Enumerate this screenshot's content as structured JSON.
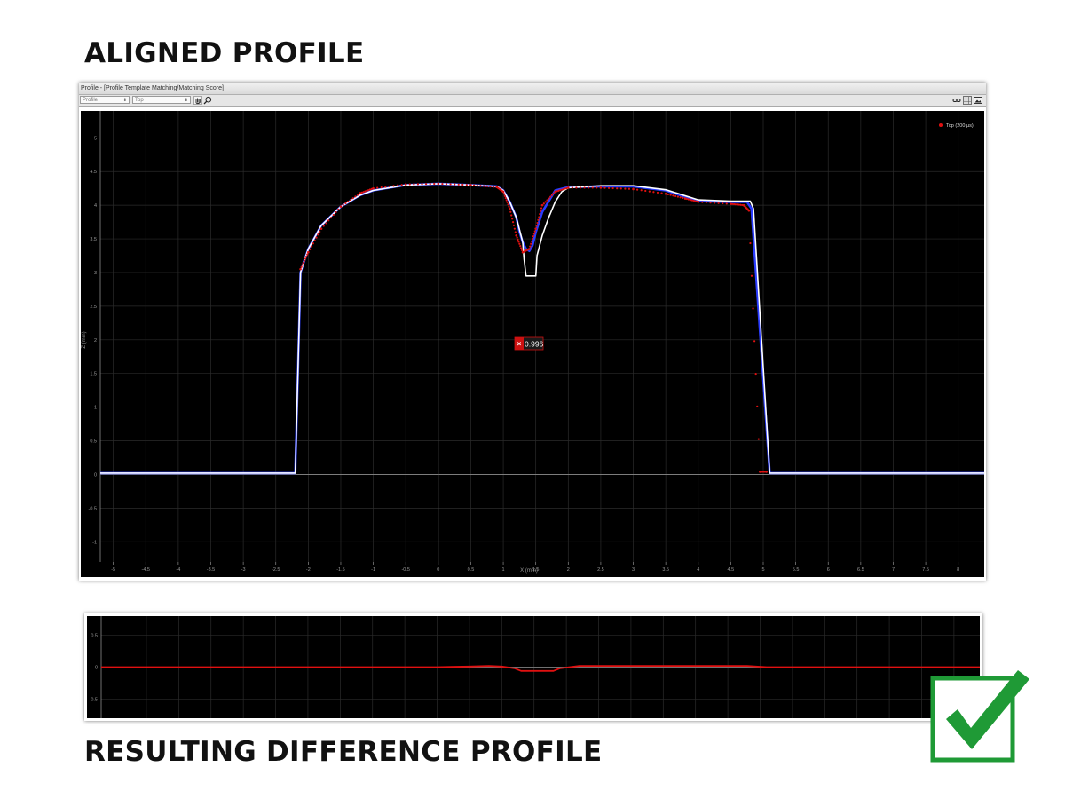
{
  "headings": {
    "top": "ALIGNED PROFILE",
    "bottom": "RESULTING DIFFERENCE PROFILE"
  },
  "window": {
    "title": "Profile - [Profile Template Matching/Matching Score]",
    "combo_1": "Profile",
    "combo_2": "Top",
    "toolbar_icons": [
      "hand-icon",
      "search-icon",
      "link-icon",
      "grid-icon",
      "screenshot-icon"
    ]
  },
  "colors": {
    "background": "#000000",
    "grid": "#2b2b2b",
    "axis": "#8c8c8c",
    "template": "#e01010",
    "profile_blue": "#2a3cff",
    "profile_white": "#ffffff",
    "badge": "#cc1111",
    "checkmark": "#1f9a36"
  },
  "badge": {
    "icon": "close-icon",
    "score": "0.996"
  },
  "chart_data": [
    {
      "type": "line",
      "xlabel": "X (mm)",
      "ylabel": "Z (mm)",
      "xlim": [
        -5.2,
        8.4
      ],
      "ylim": [
        -1.3,
        5.4
      ],
      "xticks": [
        "-5",
        "-4.5",
        "-4",
        "-3.5",
        "-3",
        "-2.5",
        "-2",
        "-1.5",
        "-1",
        "-0.5",
        "0",
        "0.5",
        "1",
        "1.5",
        "2",
        "2.5",
        "3",
        "3.5",
        "4",
        "4.5",
        "5",
        "5.5",
        "6",
        "6.5",
        "7",
        "7.5",
        "8"
      ],
      "yticks": [
        "-1",
        "-0.5",
        "0",
        "0.5",
        "1",
        "1.5",
        "2",
        "2.5",
        "3",
        "3.5",
        "4",
        "4.5",
        "5"
      ],
      "legend": {
        "position": "top-right",
        "entries": [
          "Top (200 µs)"
        ]
      },
      "grid": true,
      "series": [
        {
          "name": "",
          "color": "#2a3cff",
          "x": [
            -5.2,
            -2.2,
            -2.12,
            -2.07,
            -2.0,
            -1.8,
            -1.5,
            -1.2,
            -1.0,
            -0.5,
            0.0,
            0.5,
            0.9,
            1.0,
            1.1,
            1.2,
            1.25,
            1.3,
            1.35,
            1.4,
            1.45,
            1.5,
            1.6,
            1.8,
            2.0,
            2.5,
            3.0,
            3.5,
            4.0,
            4.5,
            4.75,
            4.82,
            5.1,
            8.4
          ],
          "y": [
            0.02,
            0.02,
            3.0,
            3.15,
            3.35,
            3.7,
            3.98,
            4.15,
            4.22,
            4.3,
            4.32,
            4.3,
            4.28,
            4.22,
            4.05,
            3.82,
            3.6,
            3.45,
            3.35,
            3.32,
            3.4,
            3.6,
            3.9,
            4.22,
            4.27,
            4.28,
            4.28,
            4.22,
            4.06,
            4.05,
            4.05,
            3.95,
            0.02,
            0.02
          ]
        },
        {
          "name": "",
          "color": "#ffffff",
          "x": [
            -5.2,
            -2.2,
            -2.12,
            -2.07,
            -2.0,
            -1.8,
            -1.5,
            -1.2,
            -1.0,
            -0.5,
            0.0,
            0.5,
            0.9,
            1.0,
            1.1,
            1.2,
            1.3,
            1.32,
            1.35,
            1.5,
            1.52,
            1.6,
            1.7,
            1.8,
            1.9,
            2.0,
            2.5,
            3.0,
            3.5,
            4.0,
            4.5,
            4.8,
            4.85,
            5.1,
            8.4
          ],
          "y": [
            0.02,
            0.02,
            3.0,
            3.15,
            3.35,
            3.7,
            3.98,
            4.15,
            4.22,
            4.3,
            4.32,
            4.3,
            4.28,
            4.22,
            4.05,
            3.82,
            3.45,
            3.2,
            2.95,
            2.95,
            3.25,
            3.55,
            3.82,
            4.05,
            4.2,
            4.26,
            4.29,
            4.29,
            4.23,
            4.08,
            4.06,
            4.06,
            3.95,
            0.02,
            0.02
          ]
        },
        {
          "name": "Top (200 µs)",
          "color": "#e01010",
          "style": "dots",
          "x": [
            -2.12,
            -2.0,
            -1.8,
            -1.5,
            -1.2,
            -1.0,
            -0.5,
            0.0,
            0.5,
            0.9,
            1.0,
            1.1,
            1.2,
            1.3,
            1.4,
            1.5,
            1.6,
            1.8,
            2.0,
            2.5,
            3.0,
            3.5,
            3.8,
            4.0,
            4.5,
            4.7,
            4.78,
            4.95,
            5.05
          ],
          "y": [
            3.05,
            3.3,
            3.65,
            3.98,
            4.18,
            4.25,
            4.31,
            4.32,
            4.3,
            4.27,
            4.2,
            3.95,
            3.55,
            3.3,
            3.35,
            3.65,
            4.0,
            4.2,
            4.26,
            4.26,
            4.24,
            4.17,
            4.1,
            4.05,
            4.02,
            4.0,
            3.92,
            0.04,
            0.04
          ]
        }
      ]
    },
    {
      "type": "line",
      "xlim": [
        -5.2,
        8.4
      ],
      "ylim": [
        -0.8,
        0.8
      ],
      "yticks": [
        "0.5",
        "0",
        "-0.5"
      ],
      "grid": true,
      "series": [
        {
          "name": "",
          "color": "#e01010",
          "x": [
            -5.2,
            0.0,
            0.5,
            0.8,
            1.0,
            1.2,
            1.3,
            1.8,
            1.9,
            2.2,
            3.0,
            4.0,
            4.8,
            5.1,
            8.4
          ],
          "y": [
            0.0,
            0.0,
            0.01,
            0.02,
            0.01,
            -0.02,
            -0.06,
            -0.06,
            -0.02,
            0.02,
            0.02,
            0.02,
            0.02,
            0.0,
            0.0
          ]
        }
      ]
    }
  ]
}
